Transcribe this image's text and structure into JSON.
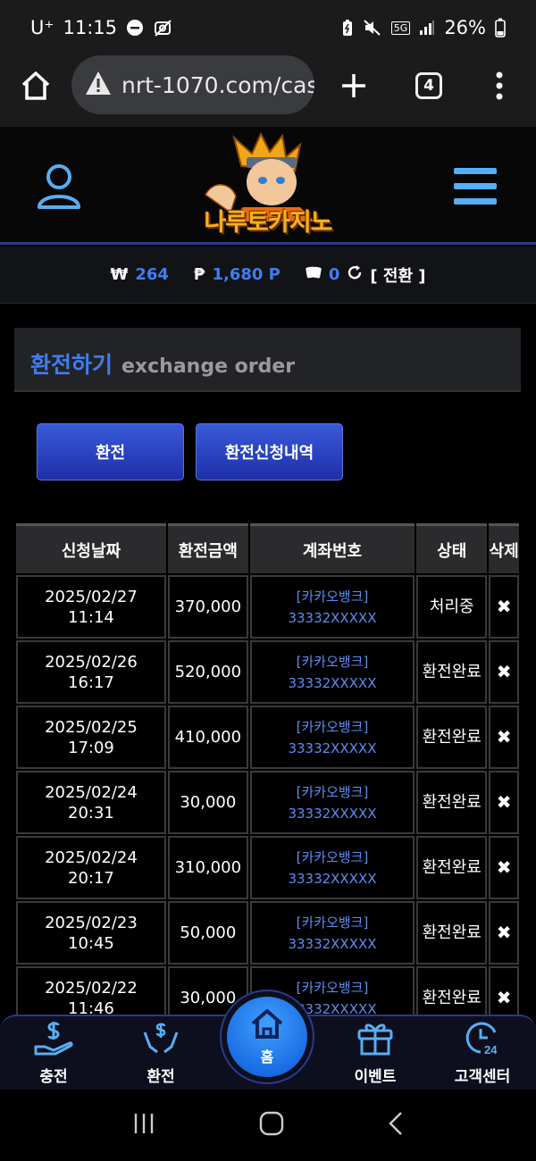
{
  "status_bar": {
    "carrier": "U⁺",
    "time": "11:15",
    "network": "5G",
    "battery": "26%"
  },
  "browser": {
    "url": "nrt-1070.com/cas",
    "tab_count": "4"
  },
  "site": {
    "logo_text": "나루토카지노"
  },
  "balance": {
    "won_symbol": "₩",
    "won_amount": "264",
    "point_symbol": "₱",
    "point_amount": "1,680 P",
    "chip_amount": "0",
    "convert_label": "[ 전환 ]"
  },
  "panel": {
    "title_ko": "환전하기",
    "title_en": "exchange order"
  },
  "buttons": {
    "exchange": "환전",
    "history": "환전신청내역"
  },
  "table": {
    "headers": [
      "신청날짜",
      "환전금액",
      "계좌번호",
      "상태",
      "삭제"
    ],
    "rows": [
      {
        "date": "2025/02/27",
        "time": "11:14",
        "amount": "370,000",
        "bank": "[카카오뱅크]",
        "account": "33332XXXXX",
        "status": "처리중",
        "delete": "✖"
      },
      {
        "date": "2025/02/26",
        "time": "16:17",
        "amount": "520,000",
        "bank": "[카카오뱅크]",
        "account": "33332XXXXX",
        "status": "환전완료",
        "delete": "✖"
      },
      {
        "date": "2025/02/25",
        "time": "17:09",
        "amount": "410,000",
        "bank": "[카카오뱅크]",
        "account": "33332XXXXX",
        "status": "환전완료",
        "delete": "✖"
      },
      {
        "date": "2025/02/24",
        "time": "20:31",
        "amount": "30,000",
        "bank": "[카카오뱅크]",
        "account": "33332XXXXX",
        "status": "환전완료",
        "delete": "✖"
      },
      {
        "date": "2025/02/24",
        "time": "20:17",
        "amount": "310,000",
        "bank": "[카카오뱅크]",
        "account": "33332XXXXX",
        "status": "환전완료",
        "delete": "✖"
      },
      {
        "date": "2025/02/23",
        "time": "10:45",
        "amount": "50,000",
        "bank": "[카카오뱅크]",
        "account": "33332XXXXX",
        "status": "환전완료",
        "delete": "✖"
      },
      {
        "date": "2025/02/22",
        "time": "11:46",
        "amount": "30,000",
        "bank": "[카카오뱅크]",
        "account": "33332XXXXX",
        "status": "환전완료",
        "delete": "✖"
      }
    ]
  },
  "bottom_nav": {
    "charge": "충전",
    "exchange": "환전",
    "home": "홈",
    "event": "이벤트",
    "support": "고객센터"
  },
  "colors": {
    "accent_blue": "#3f7df2",
    "logo_gold": "#f3b21f",
    "button_blue": "#2a45c8"
  }
}
